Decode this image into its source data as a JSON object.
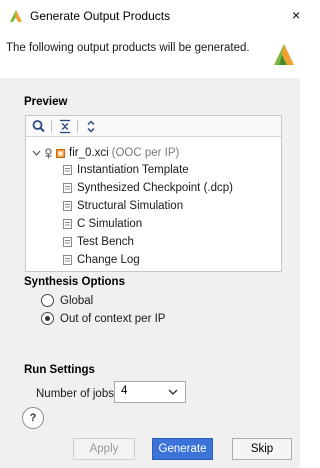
{
  "window": {
    "title": "Generate Output Products",
    "close_glyph": "×"
  },
  "header": {
    "description": "The following output products will be generated."
  },
  "preview": {
    "title": "Preview",
    "toolbar": [
      "search-icon",
      "collapse-all-icon",
      "expand-icon"
    ],
    "root": {
      "name": "fir_0.xci",
      "suffix": "(OOC per IP)"
    },
    "items": [
      "Instantiation Template",
      "Synthesized Checkpoint (.dcp)",
      "Structural Simulation",
      "C Simulation",
      "Test Bench",
      "Change Log"
    ]
  },
  "synthesis": {
    "title": "Synthesis Options",
    "options": [
      {
        "label": "Global",
        "checked": false
      },
      {
        "label": "Out of context per IP",
        "checked": true
      }
    ]
  },
  "run": {
    "title": "Run Settings",
    "jobs_label": "Number of jobs:",
    "jobs_value": "4"
  },
  "buttons": {
    "help": "?",
    "apply": "Apply",
    "generate": "Generate",
    "skip": "Skip"
  },
  "colors": {
    "accent": "#3c73d8",
    "logo_orange": "#f0a030",
    "logo_green": "#7bb83c"
  }
}
